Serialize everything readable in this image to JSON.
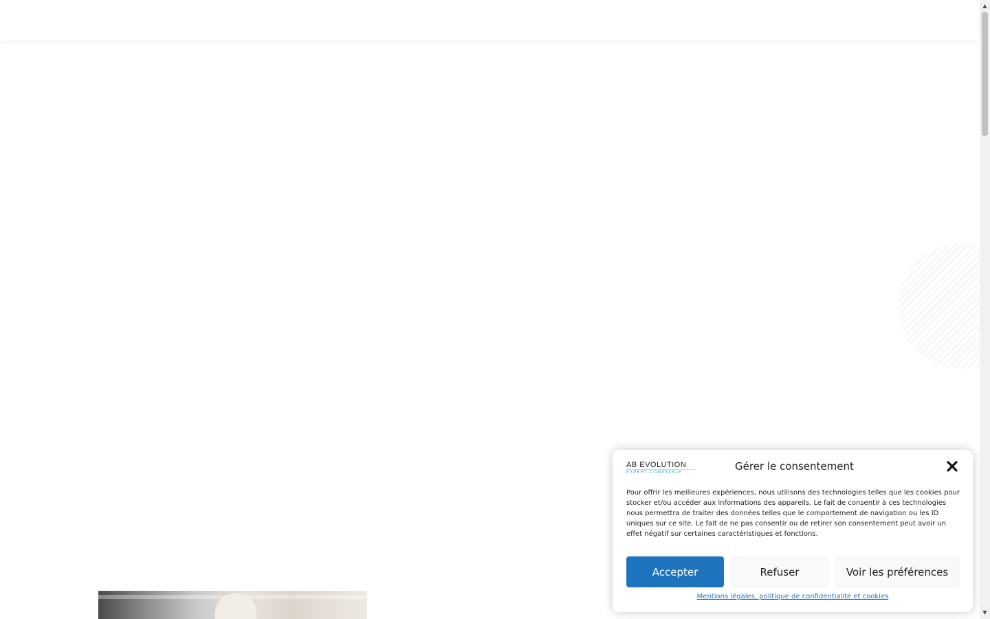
{
  "consent": {
    "logo": {
      "main": "AB EVOLUTION",
      "sub": "EXPERT-COMPTABLE"
    },
    "title": "Gérer le consentement",
    "body": "Pour offrir les meilleures expériences, nous utilisons des technologies telles que les cookies pour stocker et/ou accéder aux informations des appareils. Le fait de consentir à ces technologies nous permettra de traiter des données telles que le comportement de navigation ou les ID uniques sur ce site. Le fait de ne pas consentir ou de retirer son consentement peut avoir un effet négatif sur certaines caractéristiques et fonctions.",
    "accept_label": "Accepter",
    "refuse_label": "Refuser",
    "prefs_label": "Voir les préférences",
    "legal_link": "Mentions légales, politique de confidentialité et cookies"
  },
  "icons": {
    "close": "close-icon",
    "scroll_up": "chevron-up-icon",
    "scroll_down": "chevron-down-icon"
  },
  "colors": {
    "accent": "#1e73be",
    "logo_sub": "#3fa3c7",
    "text": "#222222",
    "button_secondary_bg": "#f9f9f9"
  }
}
